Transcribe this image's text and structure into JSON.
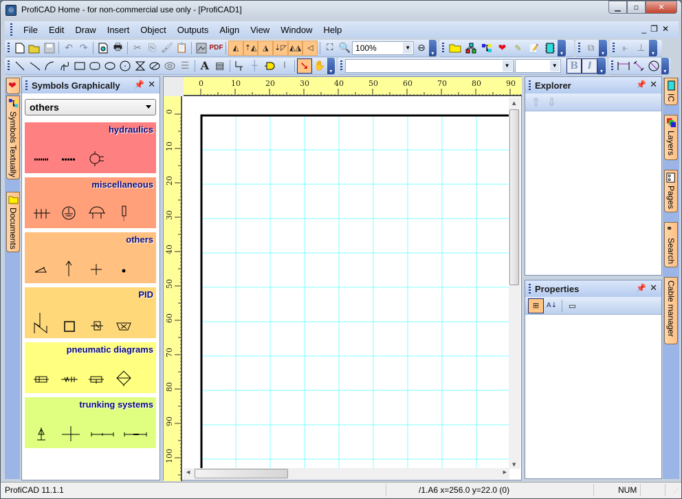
{
  "window": {
    "title": "ProfiCAD Home - for non-commercial use only - [ProfiCAD1]",
    "app_icon": "proficad-logo-icon",
    "controls": {
      "minimize": "minimize-icon",
      "maximize": "restore-icon",
      "close": "close-icon"
    }
  },
  "menu": {
    "items": [
      "File",
      "Edit",
      "Draw",
      "Insert",
      "Object",
      "Outputs",
      "Align",
      "View",
      "Window",
      "Help"
    ],
    "mdi_controls": [
      "minimize",
      "restore",
      "close"
    ]
  },
  "toolbar1": {
    "file_tools": [
      "new-document-icon",
      "open-folder-icon",
      "save-icon",
      "undo-icon",
      "redo-icon",
      "print-preview-icon",
      "print-icon",
      "cut-icon",
      "copy-icon",
      "format-painter-icon",
      "paste-icon",
      "export-image-icon",
      "pdf-icon"
    ],
    "pdf_label": "PDF",
    "transform_tools": [
      "rotate-left-icon",
      "flip-vertical-icon",
      "rotate-right-icon",
      "flip-down-icon",
      "mirror-horizontal-icon",
      "mirror-left-icon"
    ],
    "zoom_fit_icon": "zoom-fit-icon",
    "zoom_in_icon": "zoom-in-icon",
    "zoom_value": "100%",
    "zoom_out_icon": "zoom-out-icon",
    "panel_tools": [
      "folder-icon",
      "tree-icon",
      "hierarchy-icon",
      "favorites-heart-icon",
      "layers-edit-icon",
      "notes-icon",
      "ic-chip-icon"
    ],
    "group_tools": [
      "group-icon"
    ],
    "align_tools": [
      "align-left-icon",
      "align-bottom-icon"
    ]
  },
  "toolbar2": {
    "draw_tools": [
      "line-icon",
      "polyline-icon",
      "arc-icon",
      "bezier-icon",
      "rectangle-icon",
      "rounded-rectangle-icon",
      "ellipse-icon",
      "circle-icon",
      "hourglass-icon",
      "ellipse-slash-icon",
      "ellipse-shape-icon",
      "numbered-list-icon"
    ],
    "text_tools": [
      "text-icon",
      "textbox-icon"
    ],
    "connect_tools": [
      "wire-icon",
      "junction-icon",
      "component-icon",
      "bus-icon"
    ],
    "select_tool": "select-arrow-icon",
    "pan_tool": "hand-pan-icon",
    "font_name": "",
    "font_size": "",
    "bold_label": "B",
    "italic_label": "I",
    "dimension_tools": [
      "dimension-horizontal-icon",
      "dimension-diagonal-icon",
      "dimension-diameter-icon"
    ]
  },
  "left_tabs": [
    {
      "label": "",
      "icon": "favorites-heart-icon"
    },
    {
      "label": "Symbols Textually",
      "icon": "tree-icon"
    },
    {
      "label": "Documents",
      "icon": "folder-icon"
    }
  ],
  "symbols_panel": {
    "title": "Symbols Graphically",
    "category_select": "others",
    "categories": [
      {
        "name": "hydraulics",
        "color": "#ff8080",
        "symbols": [
          "hydraulic-line-1",
          "hydraulic-line-2",
          "hydraulic-pump"
        ]
      },
      {
        "name": "miscellaneous",
        "color": "#ffa07a",
        "symbols": [
          "terminal-block",
          "ground-circle",
          "dome-lamp",
          "probe"
        ]
      },
      {
        "name": "others",
        "color": "#ffc080",
        "symbols": [
          "angle",
          "arrow-up",
          "cross",
          "dot"
        ]
      },
      {
        "name": "PID",
        "color": "#ffd87a",
        "symbols": [
          "pid-line",
          "pid-box",
          "pid-valve",
          "pid-tank"
        ]
      },
      {
        "name": "pneumatic diagrams",
        "color": "#ffff80",
        "symbols": [
          "pneumatic-cylinder",
          "pneumatic-spring",
          "pneumatic-valve",
          "pneumatic-filter"
        ]
      },
      {
        "name": "trunking systems",
        "color": "#e0ff80",
        "symbols": [
          "trunk-ground",
          "trunk-cross",
          "trunk-straight",
          "trunk-joint"
        ]
      }
    ]
  },
  "canvas": {
    "h_ruler_labels": [
      "0",
      "10",
      "20",
      "30",
      "40",
      "50",
      "60",
      "70",
      "80",
      "90"
    ],
    "v_ruler_labels": [
      "0",
      "10",
      "20",
      "30",
      "40",
      "50",
      "60",
      "70",
      "80",
      "90",
      "100"
    ],
    "grid_color": "#80ffff"
  },
  "explorer_panel": {
    "title": "Explorer",
    "tools": [
      "move-up-icon",
      "move-down-icon"
    ]
  },
  "properties_panel": {
    "title": "Properties",
    "tools": [
      "categorized-icon",
      "sort-alpha-icon",
      "property-pages-icon"
    ]
  },
  "right_tabs": [
    {
      "label": "IC",
      "icon": "ic-chip-icon"
    },
    {
      "label": "Layers",
      "icon": "layers-icon"
    },
    {
      "label": "Pages",
      "icon": "pages-icon"
    },
    {
      "label": "Search",
      "icon": "binoculars-icon"
    },
    {
      "label": "Cable manager",
      "icon": ""
    }
  ],
  "status": {
    "app_version": "ProfiCAD 11.1.1",
    "position": "/1.A6  x=256.0  y=22.0 (0)",
    "num_lock": "NUM"
  }
}
